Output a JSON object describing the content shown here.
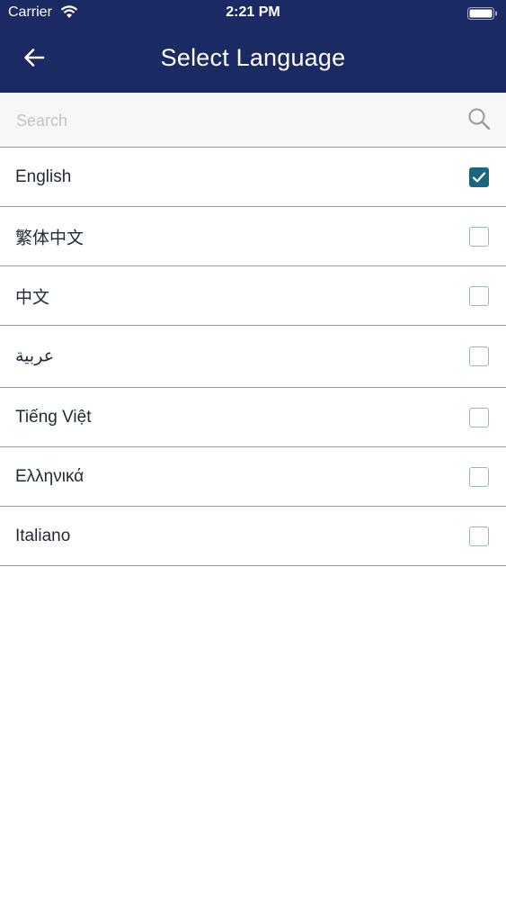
{
  "status_bar": {
    "carrier": "Carrier",
    "time": "2:21 PM"
  },
  "header": {
    "title": "Select Language",
    "back_icon": "arrow-left-icon"
  },
  "search": {
    "placeholder": "Search",
    "value": "",
    "icon": "search-icon"
  },
  "languages": [
    {
      "label": "English",
      "checked": true
    },
    {
      "label": "繁体中文",
      "checked": false
    },
    {
      "label": "中文",
      "checked": false
    },
    {
      "label": "عربية",
      "checked": false
    },
    {
      "label": "Tiếng Việt",
      "checked": false
    },
    {
      "label": "Ελληνικά",
      "checked": false
    },
    {
      "label": "Italiano",
      "checked": false
    }
  ],
  "colors": {
    "header_bg": "#1b2a63",
    "check_accent": "#1b6580"
  }
}
